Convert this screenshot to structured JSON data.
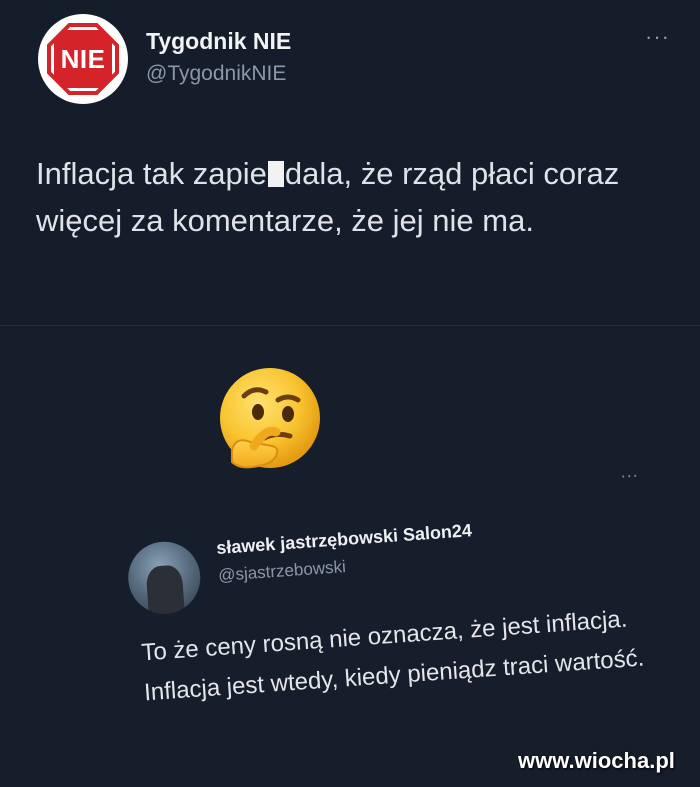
{
  "top_tweet": {
    "avatar_label": "NIE",
    "display_name": "Tygodnik NIE",
    "handle": "@TygodnikNIE",
    "more_label": "···",
    "text_before_censor": "Inflacja tak zapie",
    "text_after_censor": "dala, że rząd płaci coraz więcej za komentarze, że jej nie ma."
  },
  "emoji": {
    "icon": "thinking-face-icon"
  },
  "quoted_tweet": {
    "display_name": "sławek jastrzębowski Salon24",
    "handle": "@sjastrzebowski",
    "more_label": "···",
    "text": "To że ceny rosną nie oznacza, że jest inflacja. Inflacja jest wtedy, kiedy pieniądz traci wartość."
  },
  "watermark": "www.wiocha.pl",
  "colors": {
    "background": "#161d2b",
    "stop_red": "#d5232a",
    "secondary_text": "#8b98a5"
  }
}
